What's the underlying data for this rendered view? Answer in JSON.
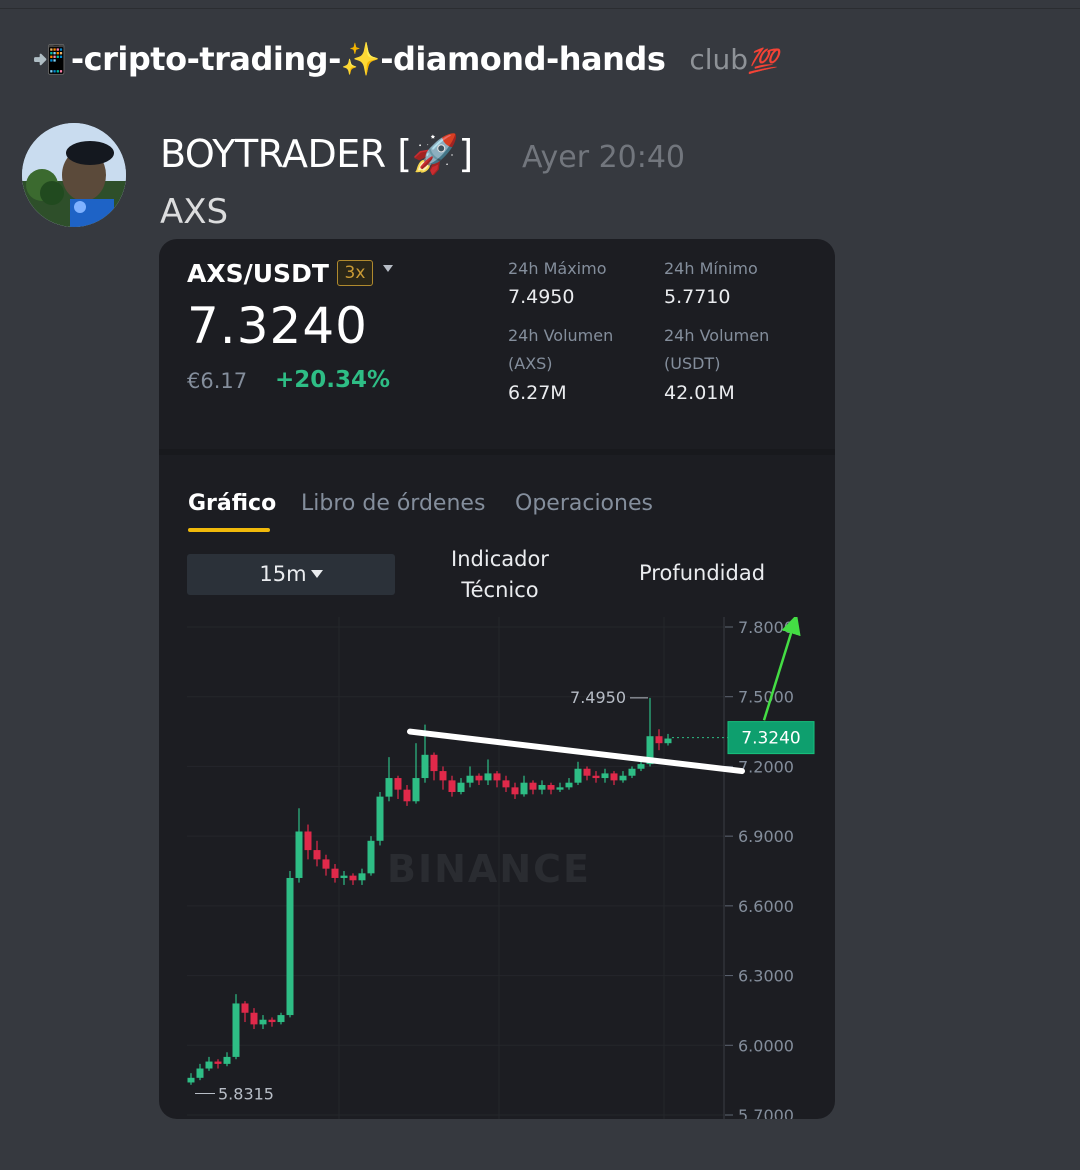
{
  "channel": {
    "emoji_prefix": "📲",
    "name": "-cripto-trading-✨-diamond-hands",
    "category": "club",
    "category_badge": "💯"
  },
  "message": {
    "author": "BOYTRADER [🚀]",
    "timestamp": "Ayer 20:40",
    "text": "AXS"
  },
  "ticker": {
    "pair": "AXS/USDT",
    "leverage": "3x",
    "last_price": "7.3240",
    "fiat_value": "€6.17",
    "change_pct": "+20.34%",
    "stats": {
      "high_label": "24h Máximo",
      "high_value": "7.4950",
      "low_label": "24h Mínimo",
      "low_value": "5.7710",
      "vol_base_label": "24h Volumen",
      "vol_base_unit": "(AXS)",
      "vol_base_value": "6.27M",
      "vol_quote_label": "24h Volumen",
      "vol_quote_unit": "(USDT)",
      "vol_quote_value": "42.01M"
    }
  },
  "tabs": [
    "Gráfico",
    "Libro de órdenes",
    "Operaciones"
  ],
  "active_tab": "Gráfico",
  "toolbar": {
    "interval": "15m",
    "indicator_line1": "Indicador",
    "indicator_line2": "Técnico",
    "depth": "Profundidad"
  },
  "colors": {
    "up": "#2ebd85",
    "down": "#e0294a",
    "accent": "#f0b90b",
    "price_tag": "#0e9f6e",
    "arrow": "#44dd44"
  },
  "chart_data": {
    "type": "candlestick",
    "ytick_labels": [
      "7.8000",
      "7.5000",
      "7.2000",
      "6.9000",
      "6.6000",
      "6.3000",
      "6.0000",
      "5.7000"
    ],
    "ylim": [
      5.7,
      7.8
    ],
    "high_marker": "7.4950",
    "low_marker": "5.8315",
    "last_price_tag": "7.3240",
    "watermark": "BINANCE",
    "candles": [
      [
        5.84,
        5.86,
        5.88,
        5.83
      ],
      [
        5.86,
        5.9,
        5.92,
        5.85
      ],
      [
        5.9,
        5.93,
        5.95,
        5.89
      ],
      [
        5.93,
        5.92,
        5.94,
        5.9
      ],
      [
        5.92,
        5.95,
        5.97,
        5.91
      ],
      [
        5.95,
        6.18,
        6.22,
        5.94
      ],
      [
        6.18,
        6.14,
        6.19,
        6.1
      ],
      [
        6.14,
        6.09,
        6.16,
        6.07
      ],
      [
        6.09,
        6.11,
        6.13,
        6.07
      ],
      [
        6.11,
        6.1,
        6.12,
        6.08
      ],
      [
        6.1,
        6.13,
        6.14,
        6.09
      ],
      [
        6.13,
        6.72,
        6.75,
        6.12
      ],
      [
        6.72,
        6.92,
        7.02,
        6.7
      ],
      [
        6.92,
        6.84,
        6.95,
        6.8
      ],
      [
        6.84,
        6.8,
        6.88,
        6.77
      ],
      [
        6.8,
        6.76,
        6.82,
        6.73
      ],
      [
        6.76,
        6.72,
        6.78,
        6.7
      ],
      [
        6.72,
        6.73,
        6.75,
        6.69
      ],
      [
        6.73,
        6.71,
        6.74,
        6.69
      ],
      [
        6.71,
        6.74,
        6.76,
        6.69
      ],
      [
        6.74,
        6.88,
        6.9,
        6.73
      ],
      [
        6.88,
        7.07,
        7.09,
        6.86
      ],
      [
        7.07,
        7.15,
        7.24,
        7.05
      ],
      [
        7.15,
        7.1,
        7.16,
        7.06
      ],
      [
        7.1,
        7.05,
        7.12,
        7.03
      ],
      [
        7.05,
        7.15,
        7.3,
        7.04
      ],
      [
        7.15,
        7.25,
        7.38,
        7.13
      ],
      [
        7.25,
        7.18,
        7.26,
        7.14
      ],
      [
        7.18,
        7.14,
        7.2,
        7.1
      ],
      [
        7.14,
        7.09,
        7.16,
        7.07
      ],
      [
        7.09,
        7.13,
        7.15,
        7.08
      ],
      [
        7.13,
        7.16,
        7.2,
        7.11
      ],
      [
        7.16,
        7.14,
        7.17,
        7.12
      ],
      [
        7.14,
        7.17,
        7.23,
        7.12
      ],
      [
        7.17,
        7.14,
        7.18,
        7.11
      ],
      [
        7.14,
        7.11,
        7.16,
        7.09
      ],
      [
        7.11,
        7.08,
        7.13,
        7.06
      ],
      [
        7.08,
        7.13,
        7.16,
        7.07
      ],
      [
        7.13,
        7.1,
        7.14,
        7.08
      ],
      [
        7.1,
        7.12,
        7.14,
        7.08
      ],
      [
        7.12,
        7.1,
        7.13,
        7.08
      ],
      [
        7.1,
        7.11,
        7.13,
        7.09
      ],
      [
        7.11,
        7.13,
        7.15,
        7.1
      ],
      [
        7.13,
        7.19,
        7.22,
        7.12
      ],
      [
        7.19,
        7.16,
        7.2,
        7.14
      ],
      [
        7.16,
        7.15,
        7.18,
        7.13
      ],
      [
        7.15,
        7.17,
        7.19,
        7.13
      ],
      [
        7.17,
        7.14,
        7.18,
        7.12
      ],
      [
        7.14,
        7.16,
        7.18,
        7.13
      ],
      [
        7.16,
        7.19,
        7.2,
        7.15
      ],
      [
        7.19,
        7.21,
        7.23,
        7.18
      ],
      [
        7.21,
        7.33,
        7.495,
        7.2
      ],
      [
        7.33,
        7.3,
        7.36,
        7.27
      ],
      [
        7.3,
        7.32,
        7.34,
        7.29
      ]
    ],
    "trendline": {
      "start_price": 7.35,
      "end_price": 7.18
    },
    "projection_arrow": {
      "start_price": 7.33,
      "end_price": 7.78
    }
  }
}
